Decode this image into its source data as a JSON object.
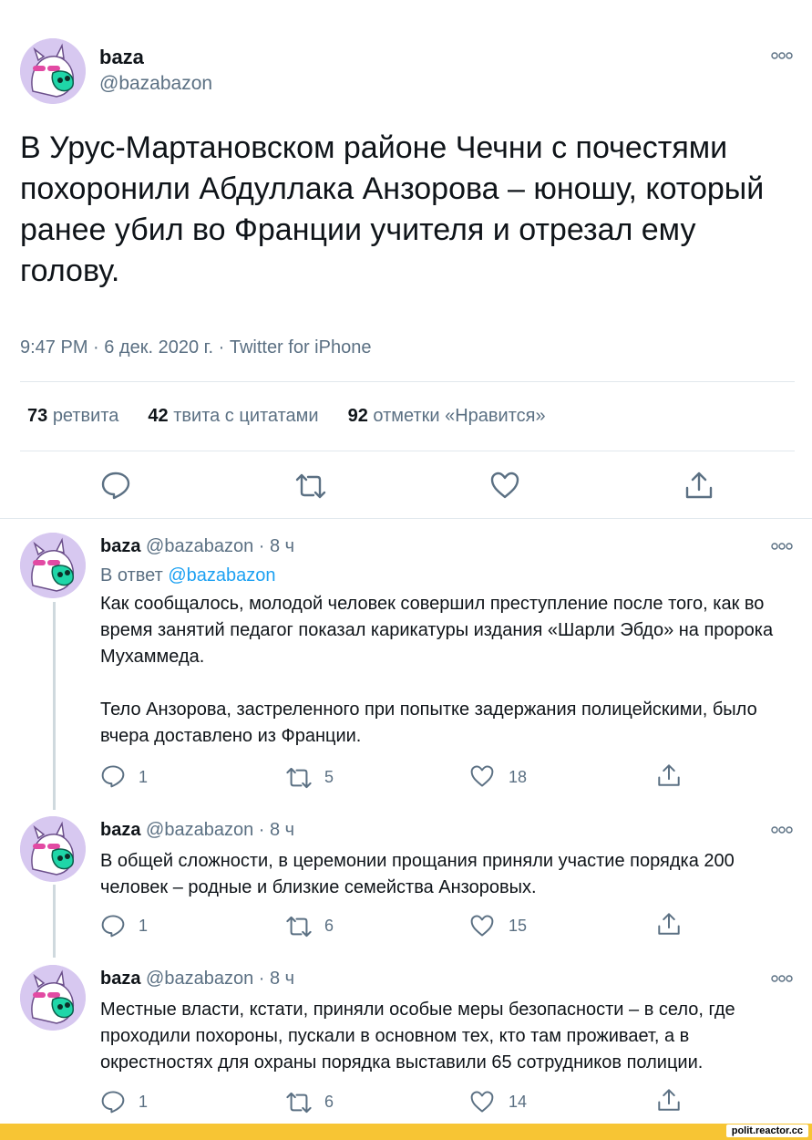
{
  "main": {
    "name": "baza",
    "handle": "@bazabazon",
    "text": "В Урус-Мартановском районе Чечни с почестями похоронили Абдуллака Анзорова – юношу, который ранее убил во Франции учителя и отрезал ему голову.",
    "meta": "9:47 PM · 6 дек. 2020 г. · Twitter for iPhone",
    "stats": [
      {
        "num": "73",
        "label": "ретвита"
      },
      {
        "num": "42",
        "label": "твита с цитатами"
      },
      {
        "num": "92",
        "label": "отметки «Нравится»"
      }
    ]
  },
  "replies": [
    {
      "name": "baza",
      "handle": "@bazabazon",
      "time": "· 8 ч",
      "reply_to_prefix": "В ответ",
      "reply_to_handle": "@bazabazon",
      "text1": "Как сообщалось, молодой человек совершил преступление после того, как во время занятий педагог показал карикатуры издания «Шарли Эбдо» на пророка Мухаммеда.",
      "text2": "Тело Анзорова, застреленного при попытке задержания полицейскими, было вчера доставлено из Франции.",
      "replies": "1",
      "retweets": "5",
      "likes": "18"
    },
    {
      "name": "baza",
      "handle": "@bazabazon",
      "time": "· 8 ч",
      "text1": "В общей сложности, в церемонии прощания приняли участие порядка 200 человек – родные и близкие семейства Анзоровых.",
      "replies": "1",
      "retweets": "6",
      "likes": "15"
    },
    {
      "name": "baza",
      "handle": "@bazabazon",
      "time": "· 8 ч",
      "text1": "Местные власти, кстати, приняли особые меры безопасности – в село, где проходили похороны, пускали в основном тех, кто там проживает, а в окрестностях для охраны порядка выставили 65 сотрудников полиции.",
      "replies": "1",
      "retweets": "6",
      "likes": "14"
    }
  ],
  "footer": {
    "label": "polit.reactor.cc"
  },
  "colors": {
    "accent": "#1da1f2",
    "muted": "#5b7083",
    "footer_bar": "#f7c534",
    "avatar_bg": "#d7c8f0"
  },
  "icons": [
    "avatar",
    "more-icon",
    "reply-icon",
    "retweet-icon",
    "like-icon",
    "share-icon"
  ]
}
